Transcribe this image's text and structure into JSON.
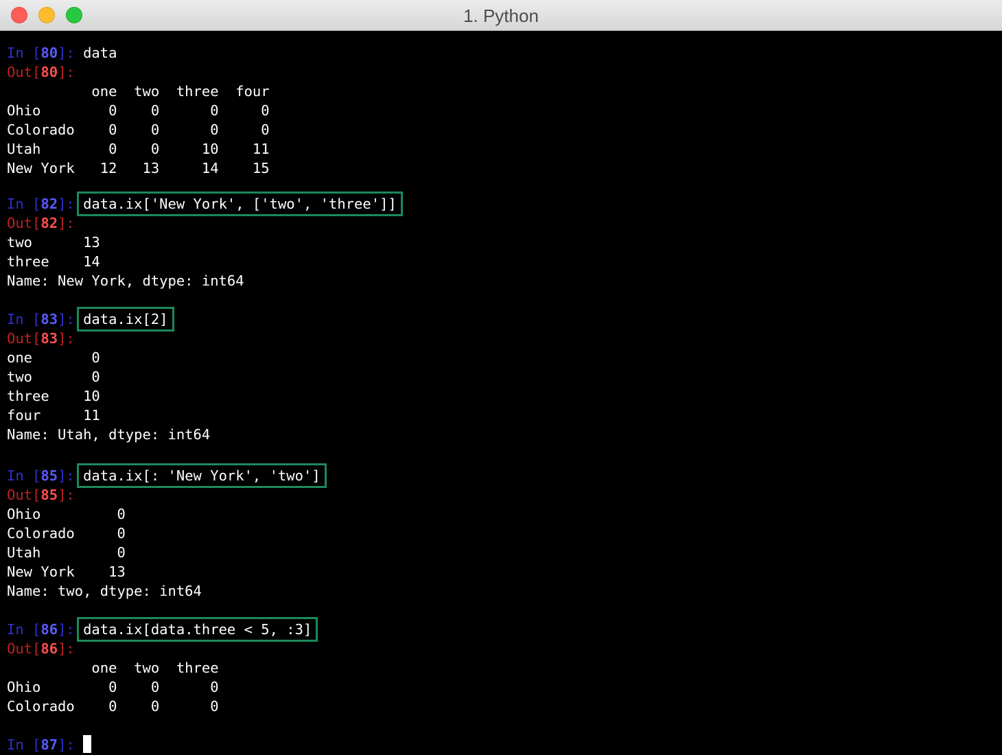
{
  "window": {
    "title": "1. Python"
  },
  "cells": [
    {
      "in": {
        "prefix": "In [",
        "n": "80",
        "suffix": "]: ",
        "code": "data"
      },
      "out": {
        "prefix": "Out[",
        "n": "80",
        "suffix": "]:"
      },
      "lines": [
        "          one  two  three  four",
        "Ohio        0    0      0     0",
        "Colorado    0    0      0     0",
        "Utah        0    0     10    11",
        "New York   12   13     14    15"
      ]
    },
    {
      "in": {
        "prefix": "In [",
        "n": "82",
        "suffix": "]: ",
        "code": "data.ix['New York', ['two', 'three']]"
      },
      "out": {
        "prefix": "Out[",
        "n": "82",
        "suffix": "]:"
      },
      "lines": [
        "two      13",
        "three    14",
        "Name: New York, dtype: int64"
      ]
    },
    {
      "in": {
        "prefix": "In [",
        "n": "83",
        "suffix": "]: ",
        "code": "data.ix[2]"
      },
      "out": {
        "prefix": "Out[",
        "n": "83",
        "suffix": "]:"
      },
      "lines": [
        "one       0",
        "two       0",
        "three    10",
        "four     11",
        "Name: Utah, dtype: int64"
      ]
    },
    {
      "in": {
        "prefix": "In [",
        "n": "85",
        "suffix": "]: ",
        "code": "data.ix[: 'New York', 'two']"
      },
      "out": {
        "prefix": "Out[",
        "n": "85",
        "suffix": "]:"
      },
      "lines": [
        "Ohio         0",
        "Colorado     0",
        "Utah         0",
        "New York    13",
        "Name: two, dtype: int64"
      ]
    },
    {
      "in": {
        "prefix": "In [",
        "n": "86",
        "suffix": "]: ",
        "code": "data.ix[data.three < 5, :3]"
      },
      "out": {
        "prefix": "Out[",
        "n": "86",
        "suffix": "]:"
      },
      "lines": [
        "          one  two  three",
        "Ohio        0    0      0",
        "Colorado    0    0      0"
      ]
    }
  ],
  "prompt": {
    "prefix": "In [",
    "n": "87",
    "suffix": "]: "
  },
  "colors": {
    "in_keyword": "#2f2fd0",
    "in_number": "#5a5aff",
    "out_keyword": "#c21f1f",
    "out_number": "#ff4f4f",
    "highlight_box": "#1a8a5c"
  }
}
